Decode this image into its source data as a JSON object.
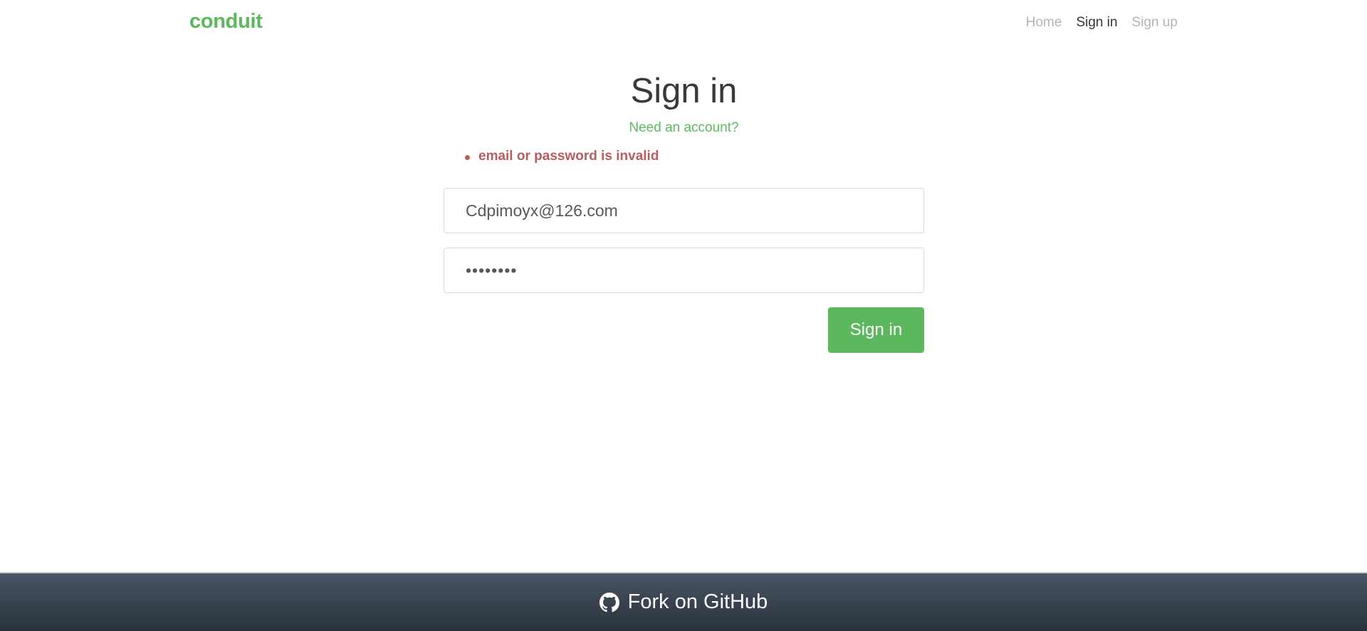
{
  "navbar": {
    "brand": "conduit",
    "links": [
      {
        "label": "Home",
        "active": false
      },
      {
        "label": "Sign in",
        "active": true
      },
      {
        "label": "Sign up",
        "active": false
      }
    ]
  },
  "auth": {
    "title": "Sign in",
    "need_account": "Need an account?",
    "errors": [
      "email or password is invalid"
    ],
    "email_value": "Cdpimoyx@126.com",
    "password_value": "••••••••",
    "submit_label": "Sign in"
  },
  "footer": {
    "icon": "github-icon",
    "label": "Fork on GitHub"
  },
  "colors": {
    "brand": "#5cb85c",
    "error": "#b85c5c",
    "footer_top": "#485563",
    "footer_bottom": "#29323c"
  }
}
